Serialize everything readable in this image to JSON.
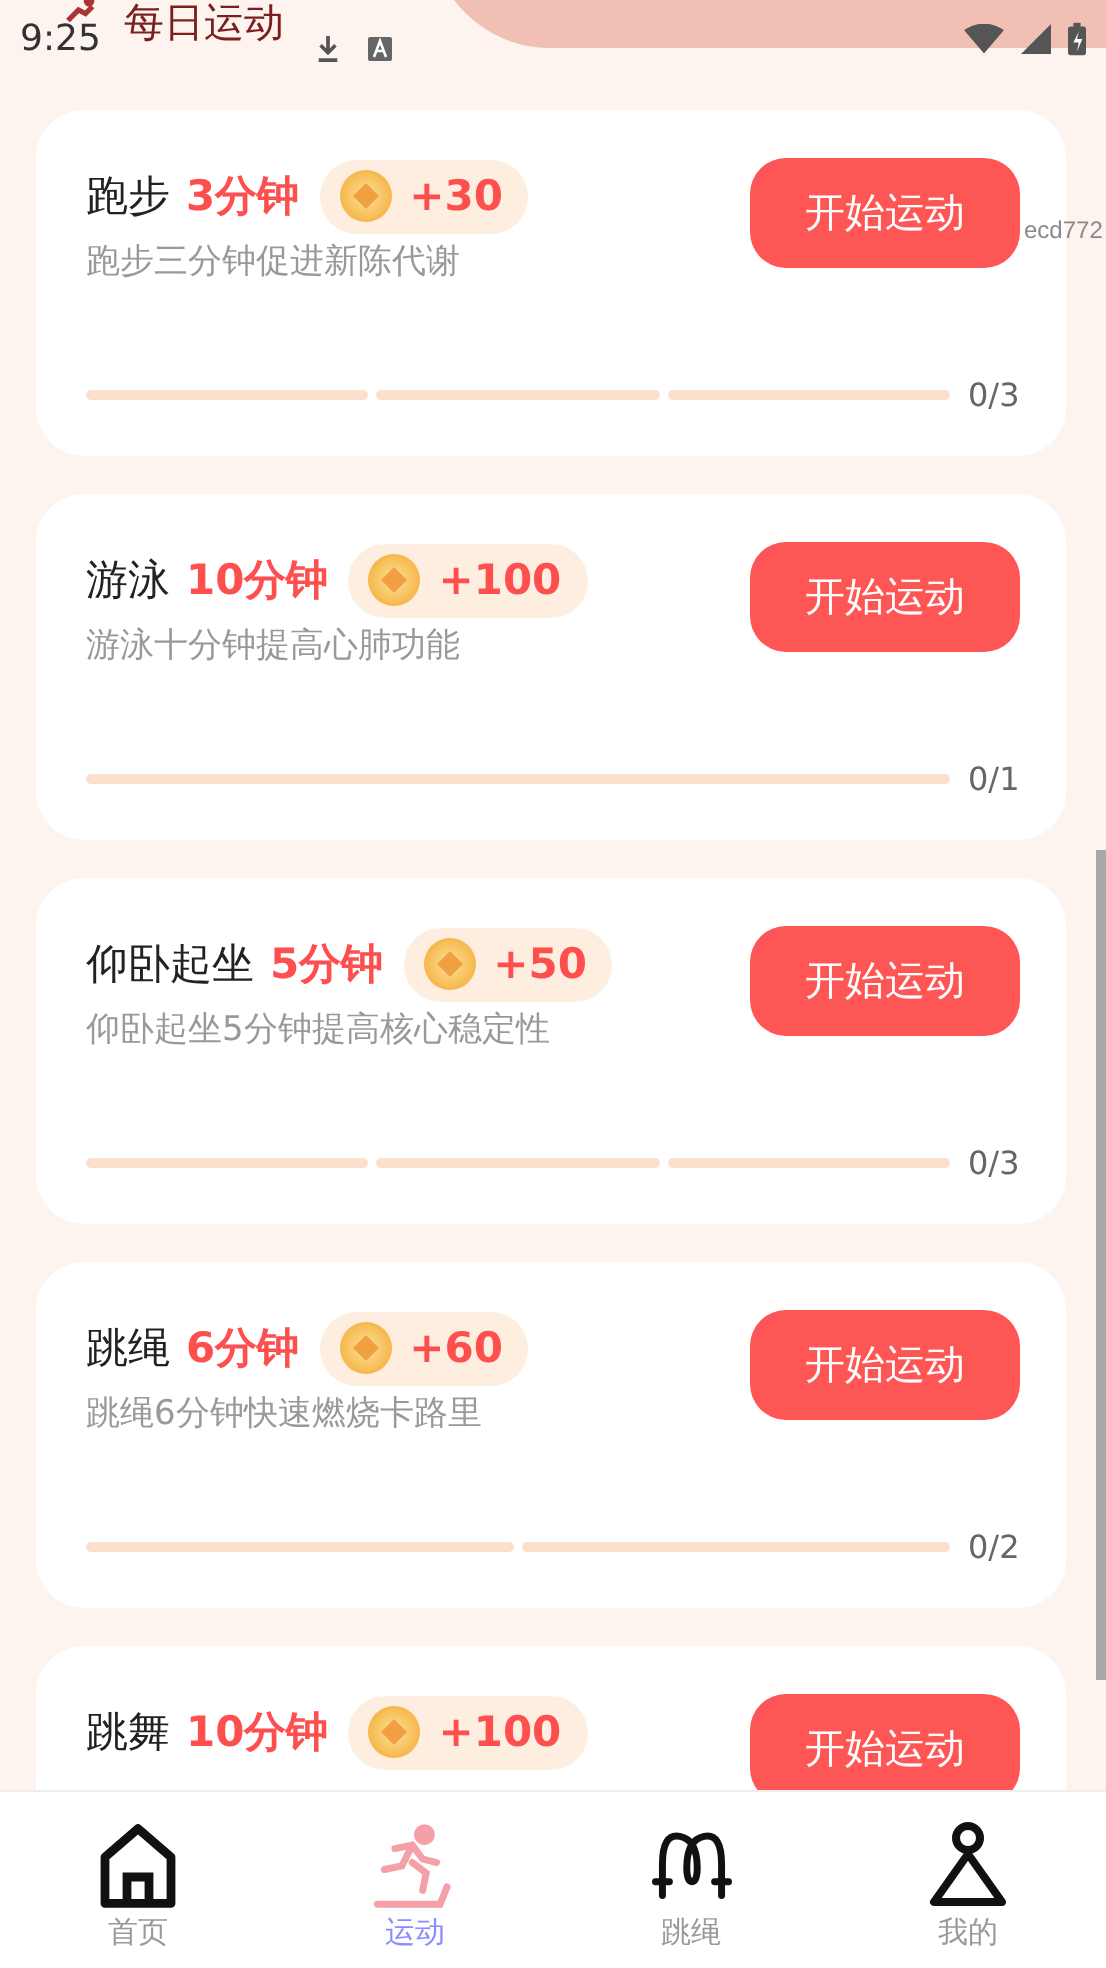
{
  "status_bar": {
    "time": "9:25"
  },
  "header": {
    "title": "每日运动"
  },
  "debug_label": "ecd772",
  "tasks": [
    {
      "name": "跑步",
      "duration": "3分钟",
      "reward": "+30",
      "description": "跑步三分钟促进新陈代谢",
      "button": "开始运动",
      "progress": "0/3",
      "steps": [
        {
          "done": false
        },
        {
          "done": false
        },
        {
          "done": false
        }
      ]
    },
    {
      "name": "游泳",
      "duration": "10分钟",
      "reward": "+100",
      "description": "游泳十分钟提高心肺功能",
      "button": "开始运动",
      "progress": "0/1",
      "steps": [
        {
          "done": false
        }
      ]
    },
    {
      "name": "仰卧起坐",
      "duration": "5分钟",
      "reward": "+50",
      "description": "仰卧起坐5分钟提高核心稳定性",
      "button": "开始运动",
      "progress": "0/3",
      "steps": [
        {
          "done": false
        },
        {
          "done": false
        },
        {
          "done": false
        }
      ]
    },
    {
      "name": "跳绳",
      "duration": "6分钟",
      "reward": "+60",
      "description": "跳绳6分钟快速燃烧卡路里",
      "button": "开始运动",
      "progress": "0/2",
      "steps": [
        {
          "done": false
        },
        {
          "done": false
        }
      ]
    },
    {
      "name": "跳舞",
      "duration": "10分钟",
      "reward": "+100",
      "button": "开始运动"
    }
  ],
  "tab_bar": [
    {
      "kind": "home",
      "label": "首页",
      "selected": false
    },
    {
      "kind": "run",
      "label": "运动",
      "selected": true
    },
    {
      "kind": "rope",
      "label": "跳绳",
      "selected": false
    },
    {
      "kind": "person",
      "label": "我的",
      "selected": false
    }
  ]
}
